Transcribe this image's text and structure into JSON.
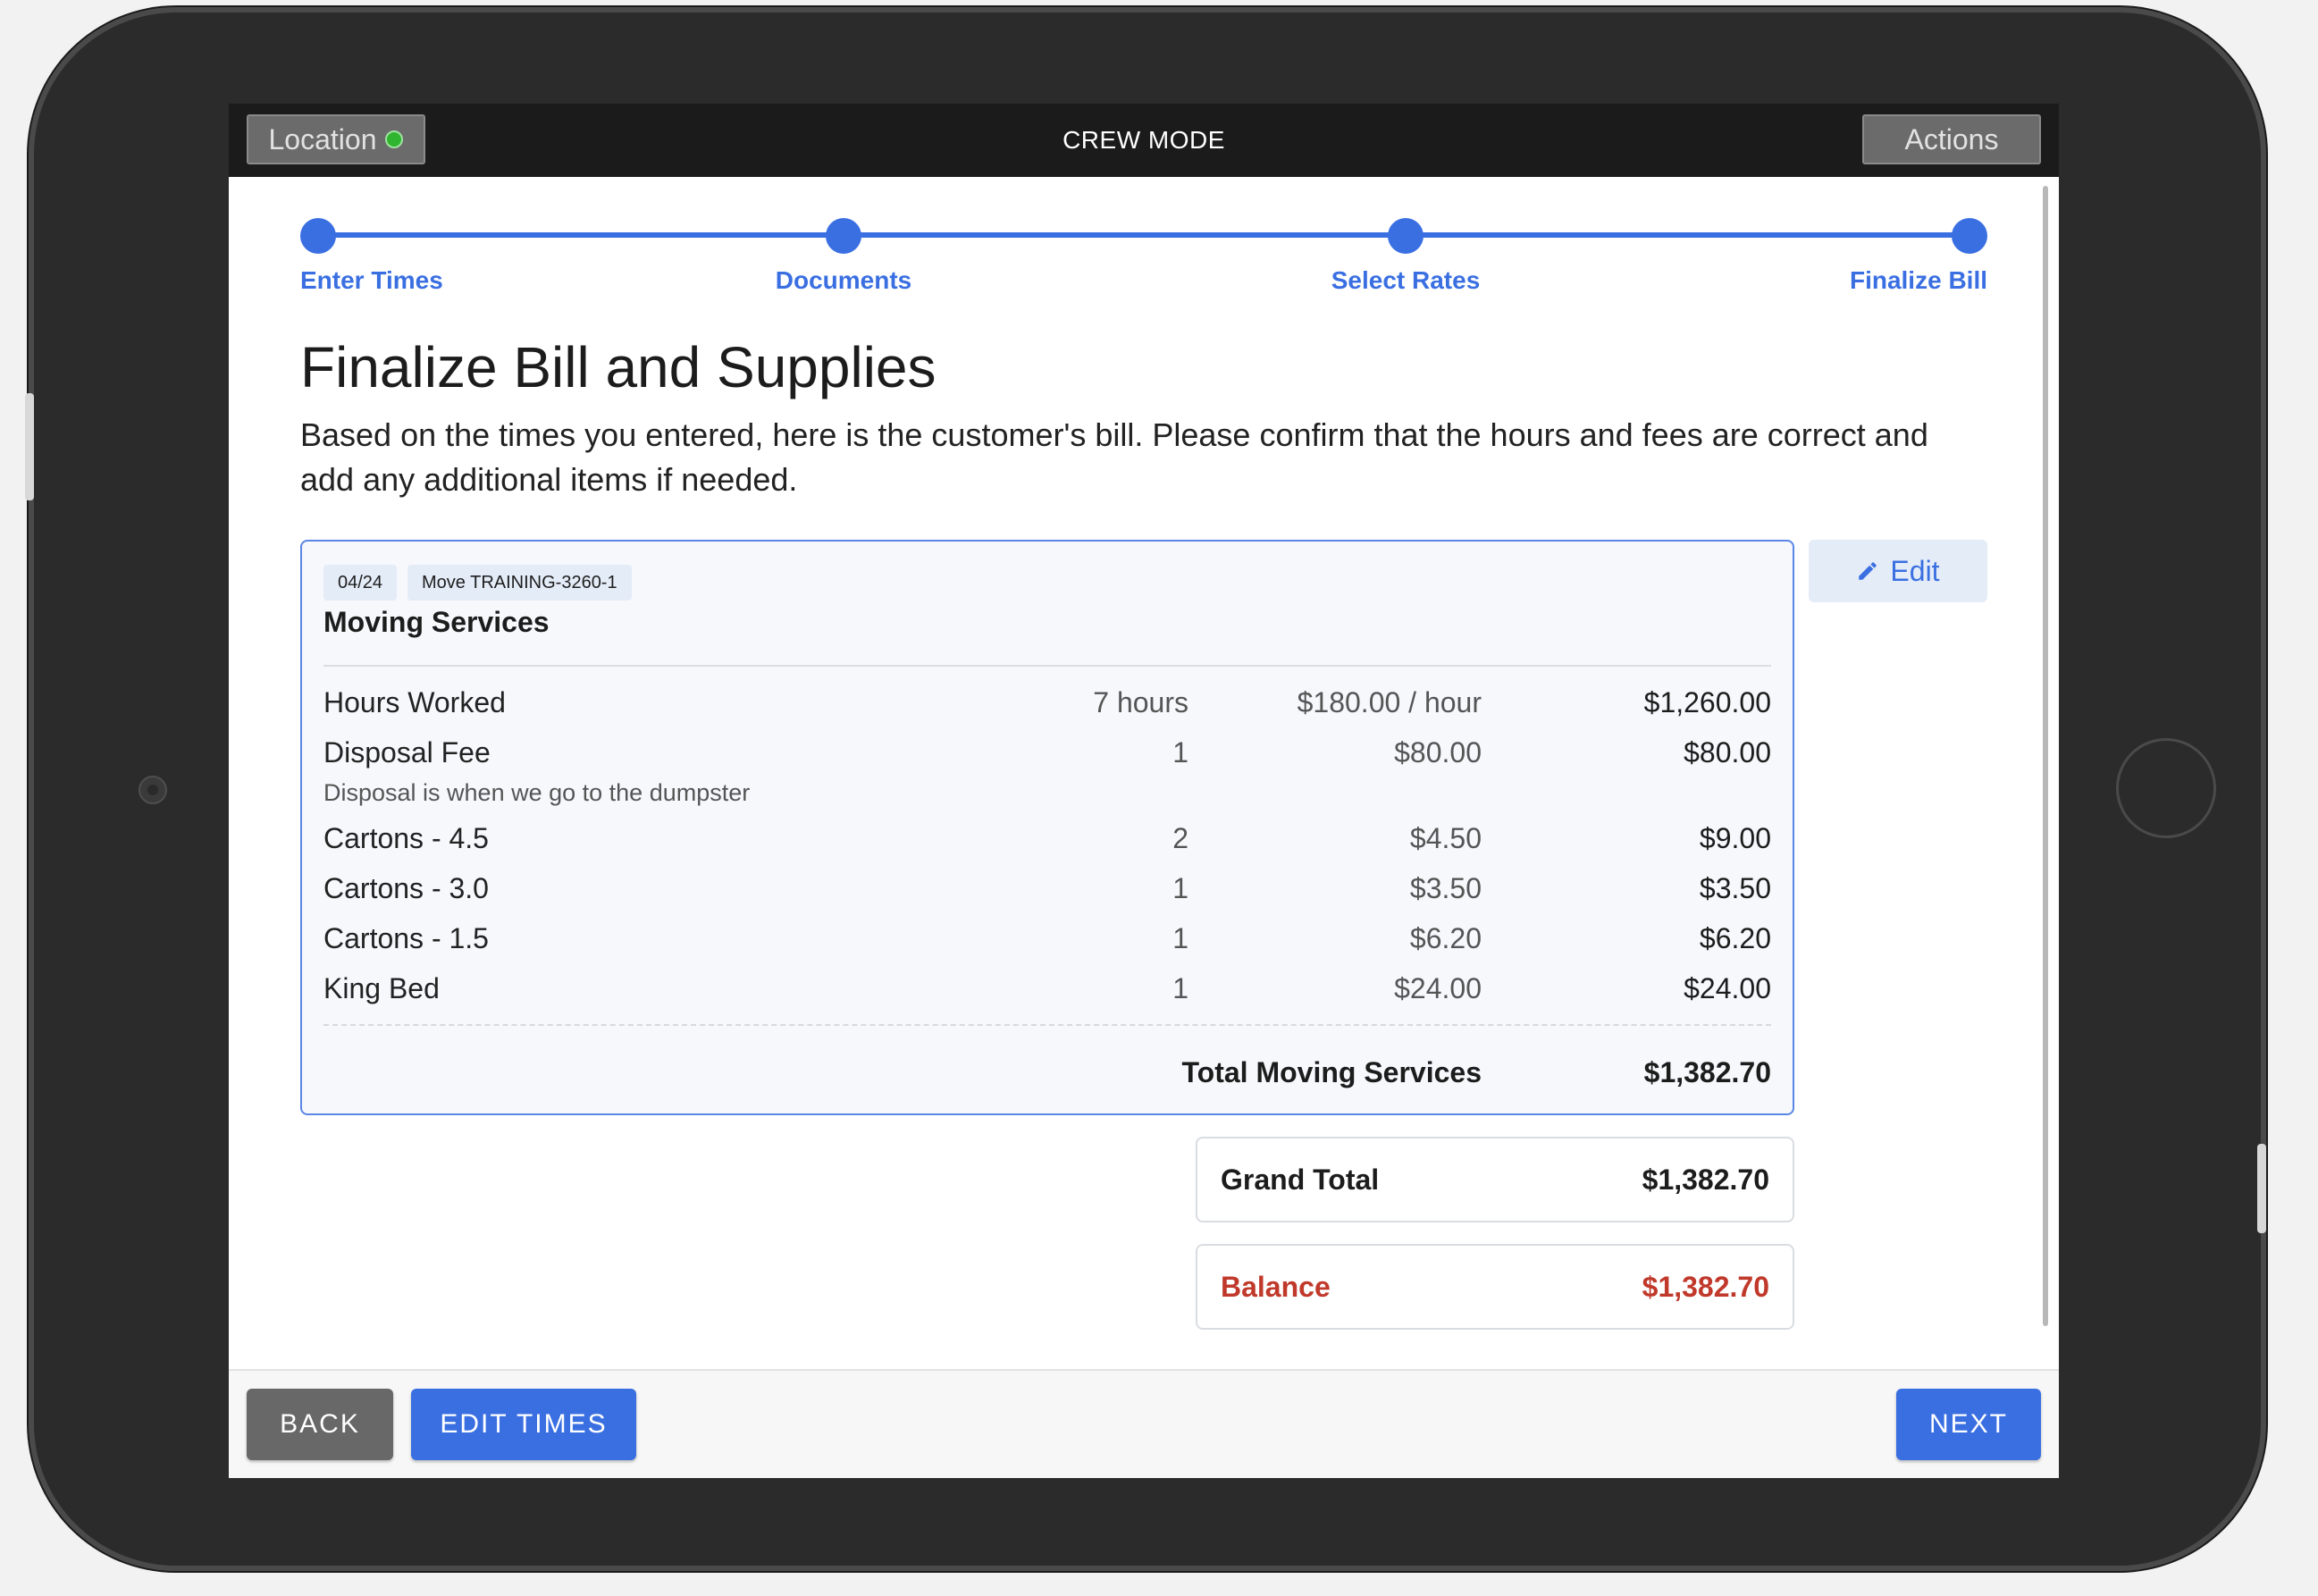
{
  "topbar": {
    "location_label": "Location",
    "title": "CREW MODE",
    "actions_label": "Actions"
  },
  "stepper": {
    "steps": [
      {
        "label": "Enter Times"
      },
      {
        "label": "Documents"
      },
      {
        "label": "Select Rates"
      },
      {
        "label": "Finalize Bill"
      }
    ]
  },
  "page": {
    "title": "Finalize Bill and Supplies",
    "description": "Based on the times you entered, here is the customer's bill. Please confirm that the hours and fees are correct and add any additional items if needed."
  },
  "bill": {
    "date_tag": "04/24",
    "move_tag": "Move TRAINING-3260-1",
    "title": "Moving Services",
    "edit_label": "Edit",
    "items": [
      {
        "name": "Hours Worked",
        "qty": "7 hours",
        "rate": "$180.00 / hour",
        "amount": "$1,260.00"
      },
      {
        "name": "Disposal Fee",
        "qty": "1",
        "rate": "$80.00",
        "amount": "$80.00",
        "note": "Disposal is when we go to the dumpster"
      },
      {
        "name": "Cartons - 4.5",
        "qty": "2",
        "rate": "$4.50",
        "amount": "$9.00"
      },
      {
        "name": "Cartons - 3.0",
        "qty": "1",
        "rate": "$3.50",
        "amount": "$3.50"
      },
      {
        "name": "Cartons - 1.5",
        "qty": "1",
        "rate": "$6.20",
        "amount": "$6.20"
      },
      {
        "name": "King Bed",
        "qty": "1",
        "rate": "$24.00",
        "amount": "$24.00"
      }
    ],
    "total_label": "Total Moving Services",
    "total_value": "$1,382.70"
  },
  "summary": {
    "grand_total_label": "Grand Total",
    "grand_total_value": "$1,382.70",
    "balance_label": "Balance",
    "balance_value": "$1,382.70"
  },
  "footer": {
    "back_label": "BACK",
    "edit_times_label": "EDIT TIMES",
    "next_label": "NEXT"
  },
  "colors": {
    "accent": "#3a6fe2",
    "balance": "#c0392b",
    "location_status": "#2fb52f"
  }
}
